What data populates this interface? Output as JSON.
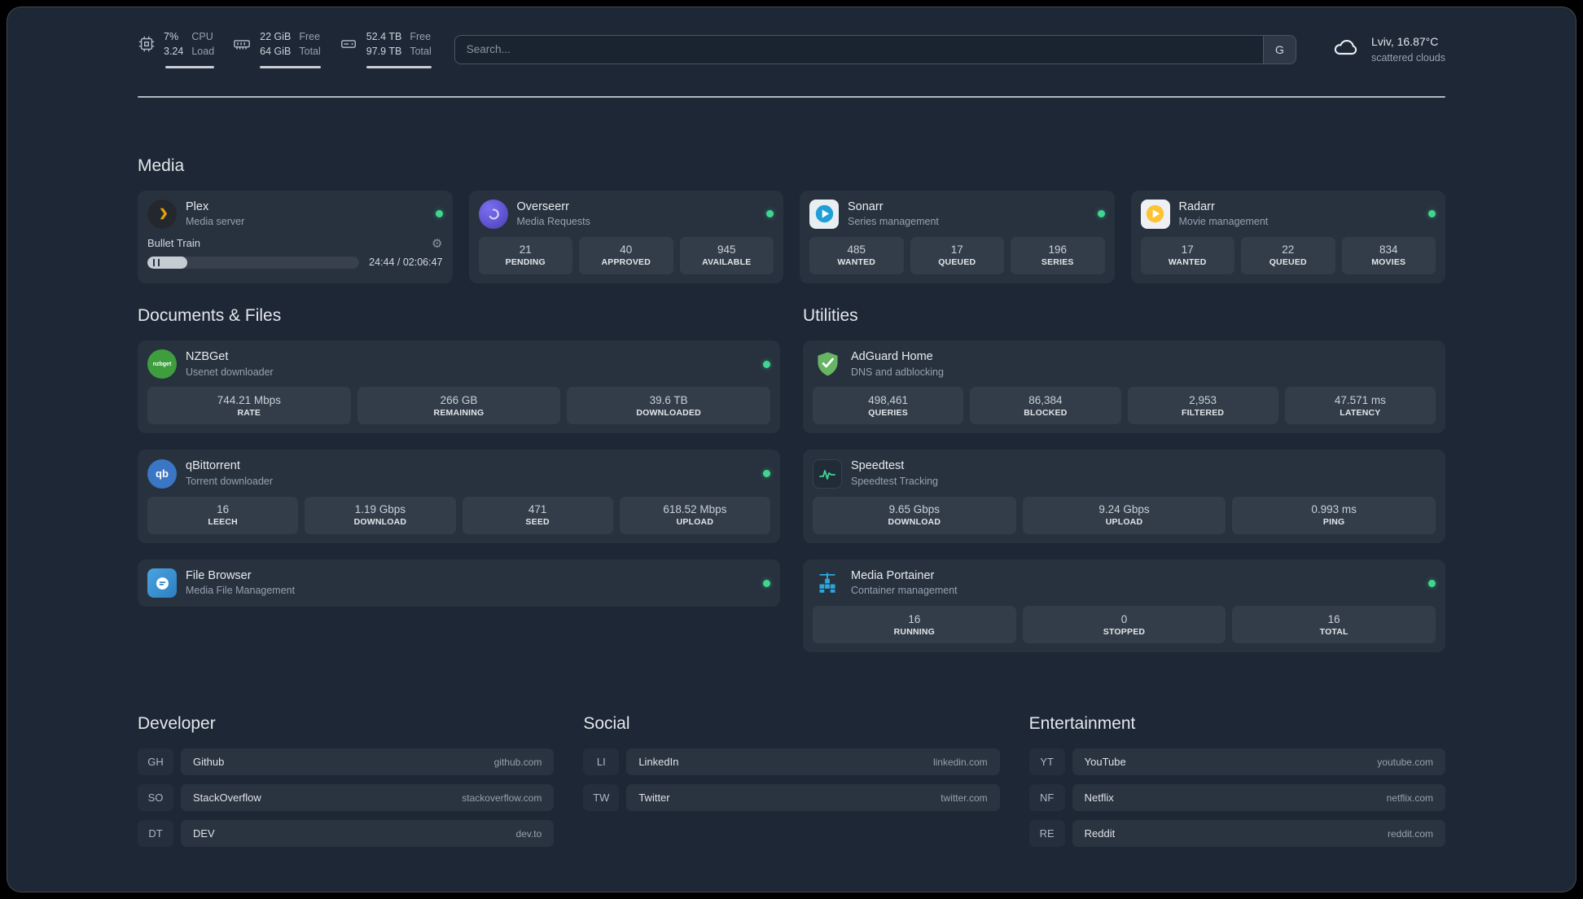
{
  "topbar": {
    "resources": [
      {
        "icon": "cpu-icon",
        "values": [
          "7%",
          "3.24"
        ],
        "labels": [
          "CPU",
          "Load"
        ]
      },
      {
        "icon": "memory-icon",
        "values": [
          "22 GiB",
          "64 GiB"
        ],
        "labels": [
          "Free",
          "Total"
        ]
      },
      {
        "icon": "disk-icon",
        "values": [
          "52.4 TB",
          "97.9 TB"
        ],
        "labels": [
          "Free",
          "Total"
        ]
      }
    ],
    "search": {
      "placeholder": "Search...",
      "provider_label": "G"
    },
    "weather": {
      "icon": "cloud-icon",
      "location": "Lviv, 16.87°C",
      "condition": "scattered clouds"
    }
  },
  "sections": {
    "media": {
      "title": "Media",
      "plex": {
        "title": "Plex",
        "subtitle": "Media server",
        "status": "online",
        "now_playing": "Bullet Train",
        "time": "24:44 / 02:06:47",
        "progress_percent": 19
      },
      "overseerr": {
        "title": "Overseerr",
        "subtitle": "Media Requests",
        "status": "online",
        "stats": [
          {
            "value": "21",
            "label": "PENDING"
          },
          {
            "value": "40",
            "label": "APPROVED"
          },
          {
            "value": "945",
            "label": "AVAILABLE"
          }
        ]
      },
      "sonarr": {
        "title": "Sonarr",
        "subtitle": "Series management",
        "status": "online",
        "stats": [
          {
            "value": "485",
            "label": "WANTED"
          },
          {
            "value": "17",
            "label": "QUEUED"
          },
          {
            "value": "196",
            "label": "SERIES"
          }
        ]
      },
      "radarr": {
        "title": "Radarr",
        "subtitle": "Movie management",
        "status": "online",
        "stats": [
          {
            "value": "17",
            "label": "WANTED"
          },
          {
            "value": "22",
            "label": "QUEUED"
          },
          {
            "value": "834",
            "label": "MOVIES"
          }
        ]
      }
    },
    "documents": {
      "title": "Documents & Files",
      "nzbget": {
        "title": "NZBGet",
        "subtitle": "Usenet downloader",
        "status": "online",
        "logo_text": "nzbget",
        "stats": [
          {
            "value": "744.21 Mbps",
            "label": "RATE"
          },
          {
            "value": "266 GB",
            "label": "REMAINING"
          },
          {
            "value": "39.6 TB",
            "label": "DOWNLOADED"
          }
        ]
      },
      "qbittorrent": {
        "title": "qBittorrent",
        "subtitle": "Torrent downloader",
        "status": "online",
        "logo_text": "qb",
        "stats": [
          {
            "value": "16",
            "label": "LEECH"
          },
          {
            "value": "1.19 Gbps",
            "label": "DOWNLOAD"
          },
          {
            "value": "471",
            "label": "SEED"
          },
          {
            "value": "618.52 Mbps",
            "label": "UPLOAD"
          }
        ]
      },
      "filebrowser": {
        "title": "File Browser",
        "subtitle": "Media File Management",
        "status": "online"
      }
    },
    "utilities": {
      "title": "Utilities",
      "adguard": {
        "title": "AdGuard Home",
        "subtitle": "DNS and adblocking",
        "stats": [
          {
            "value": "498,461",
            "label": "QUERIES"
          },
          {
            "value": "86,384",
            "label": "BLOCKED"
          },
          {
            "value": "2,953",
            "label": "FILTERED"
          },
          {
            "value": "47.571 ms",
            "label": "LATENCY"
          }
        ]
      },
      "speedtest": {
        "title": "Speedtest",
        "subtitle": "Speedtest Tracking",
        "stats": [
          {
            "value": "9.65 Gbps",
            "label": "DOWNLOAD"
          },
          {
            "value": "9.24 Gbps",
            "label": "UPLOAD"
          },
          {
            "value": "0.993 ms",
            "label": "PING"
          }
        ]
      },
      "portainer": {
        "title": "Media Portainer",
        "subtitle": "Container management",
        "status": "online",
        "stats": [
          {
            "value": "16",
            "label": "RUNNING"
          },
          {
            "value": "0",
            "label": "STOPPED"
          },
          {
            "value": "16",
            "label": "TOTAL"
          }
        ]
      }
    }
  },
  "bookmarks": {
    "developer": {
      "title": "Developer",
      "items": [
        {
          "abbr": "GH",
          "name": "Github",
          "url": "github.com"
        },
        {
          "abbr": "SO",
          "name": "StackOverflow",
          "url": "stackoverflow.com"
        },
        {
          "abbr": "DT",
          "name": "DEV",
          "url": "dev.to"
        }
      ]
    },
    "social": {
      "title": "Social",
      "items": [
        {
          "abbr": "LI",
          "name": "LinkedIn",
          "url": "linkedin.com"
        },
        {
          "abbr": "TW",
          "name": "Twitter",
          "url": "twitter.com"
        }
      ]
    },
    "entertainment": {
      "title": "Entertainment",
      "items": [
        {
          "abbr": "YT",
          "name": "YouTube",
          "url": "youtube.com"
        },
        {
          "abbr": "NF",
          "name": "Netflix",
          "url": "netflix.com"
        },
        {
          "abbr": "RE",
          "name": "Reddit",
          "url": "reddit.com"
        }
      ]
    }
  },
  "colors": {
    "status_online": "#3fd68f",
    "plex_accent": "#e5a00d",
    "adguard_green": "#67b463",
    "portainer_blue": "#2aa7dd"
  }
}
